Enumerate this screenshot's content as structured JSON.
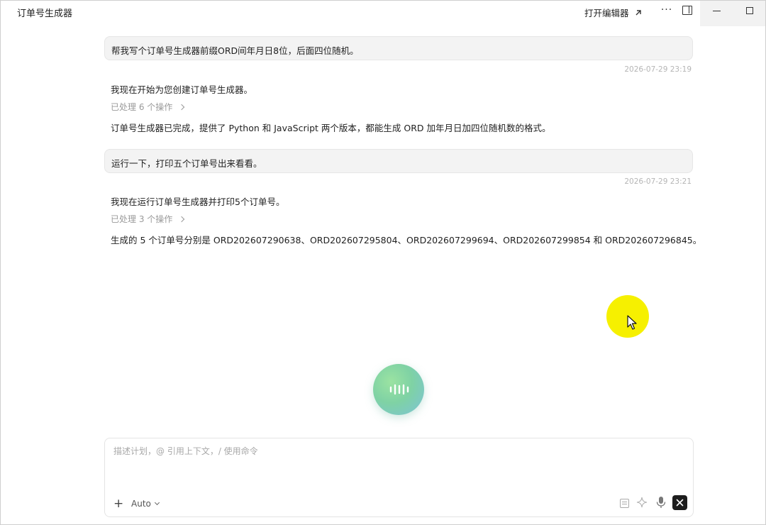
{
  "window": {
    "title": "订单号生成器",
    "open_editor_label": "打开编辑器"
  },
  "icons": {
    "open_editor": "arrow-up-right-icon",
    "more": "more-horizontal-icon",
    "panel": "panel-toggle-icon",
    "minimize": "minimize-icon",
    "maximize": "maximize-icon",
    "voice": "voice-wave-icon",
    "add": "plus-icon",
    "doc": "document-icon",
    "sparkle": "sparkle-icon",
    "mic": "microphone-icon",
    "stop": "stop-icon",
    "cursor": "mouse-pointer-icon"
  },
  "conversation": {
    "turns": [
      {
        "user": "帮我写个订单号生成器前缀ORD间年月日8位，后面四位随机。",
        "time": "2026-07-29 23:19",
        "intro": "我现在开始为您创建订单号生成器。",
        "processed": "已处理 6 个操作",
        "result": "订单号生成器已完成，提供了 Python 和 JavaScript 两个版本，都能生成 ORD 加年月日加四位随机数的格式。"
      },
      {
        "user": "运行一下，打印五个订单号出来看看。",
        "time": "2026-07-29 23:21",
        "intro": "我现在运行订单号生成器并打印5个订单号。",
        "processed": "已处理 3 个操作",
        "result": "生成的 5 个订单号分别是 ORD202607290638、ORD202607295804、ORD202607299694、ORD202607299854 和 ORD202607296845。"
      }
    ]
  },
  "composer": {
    "placeholder": "描述计划，@ 引用上下文，/ 使用命令",
    "value": "",
    "mode": "Auto"
  },
  "colors": {
    "cursor_highlight": "#f6f000",
    "voice_orb_start": "#9be3a2",
    "voice_orb_end": "#7cc3d8",
    "stop_button": "#1d1d1d"
  }
}
